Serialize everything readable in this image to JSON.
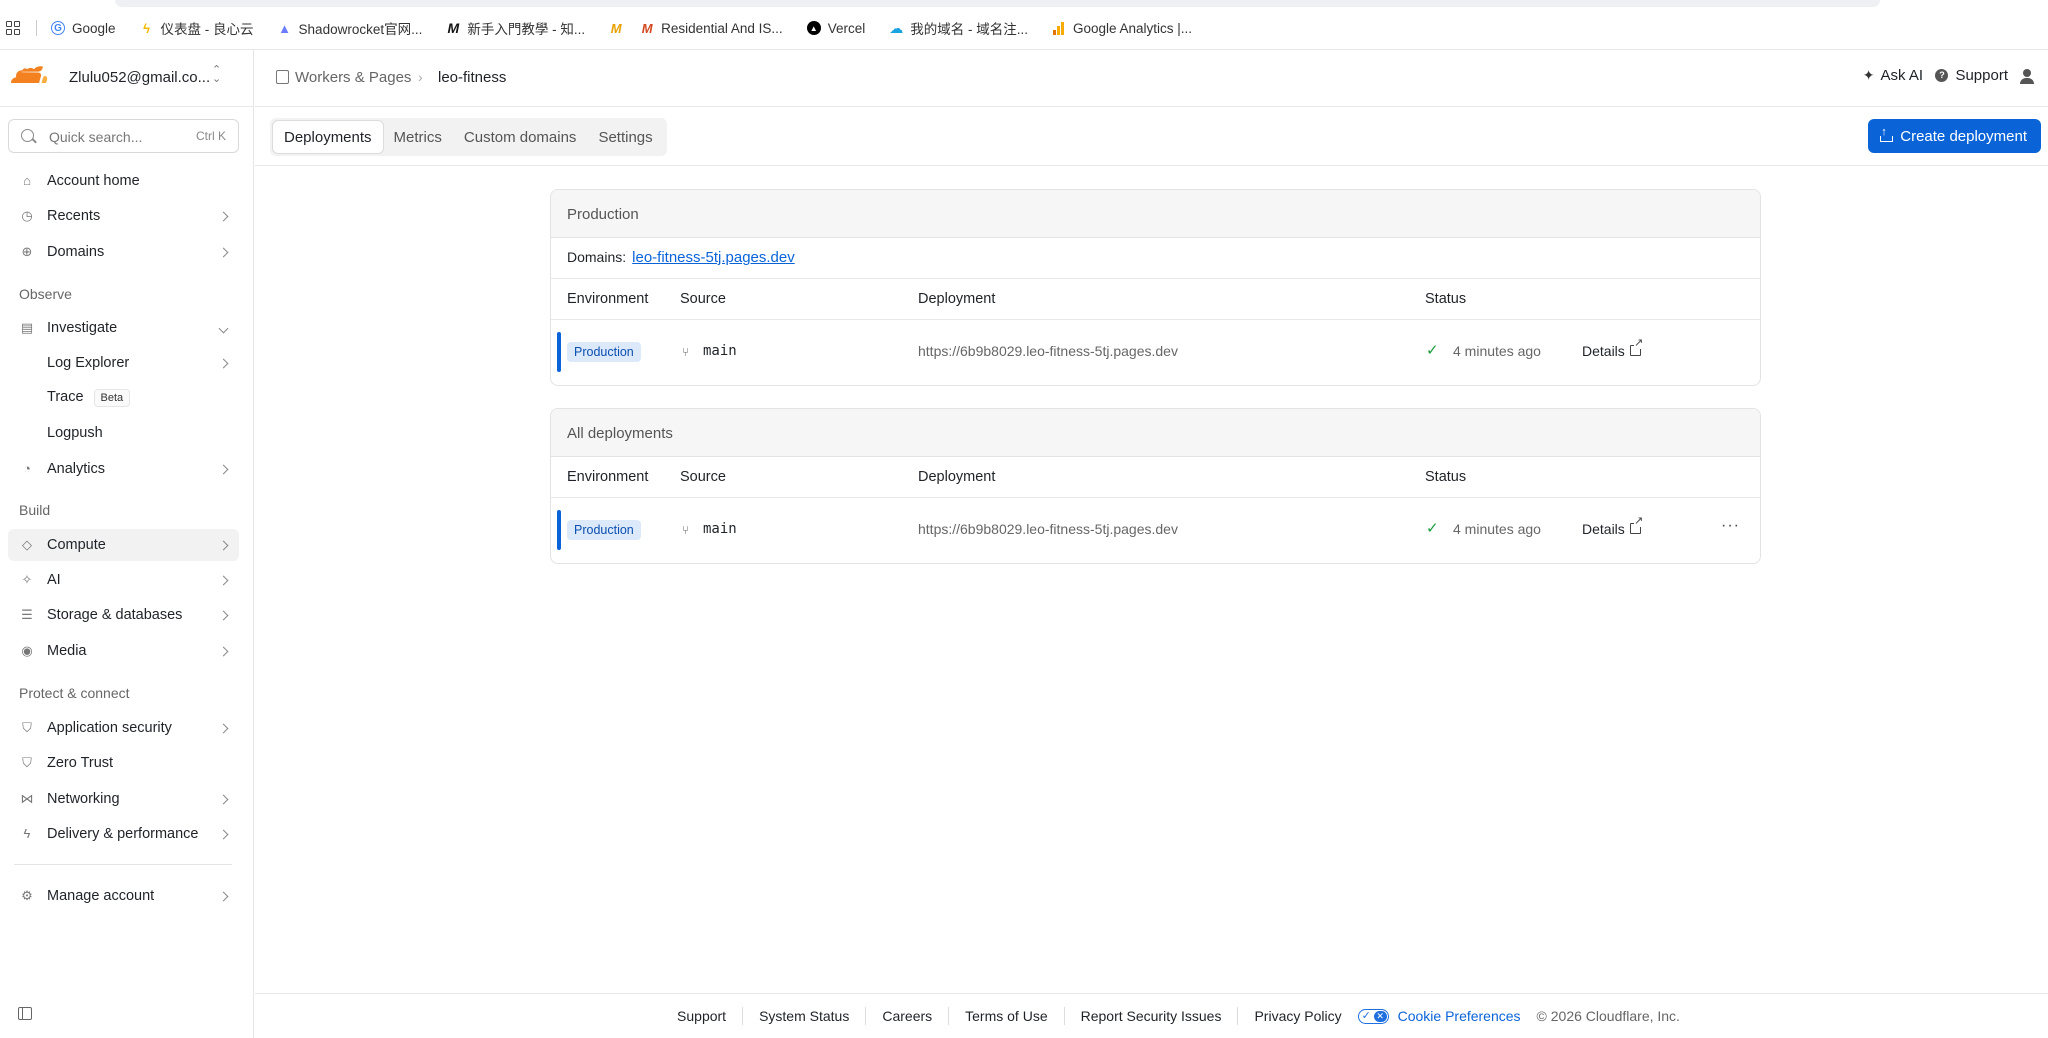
{
  "bookmarks": [
    {
      "label": "Google",
      "icon": "google-icon",
      "color": "#4285f4"
    },
    {
      "label": "仪表盘 - 良心云",
      "icon": "lightning-icon",
      "color": "#f2b800"
    },
    {
      "label": "Shadowrocket官网...",
      "icon": "rocket-icon",
      "color": "#6b7cff"
    },
    {
      "label": "新手入門教學 - 知...",
      "icon": "m-logo-icon",
      "color": "#111111"
    },
    {
      "label": "",
      "icon": "m-logo-icon",
      "color": "#e8a000"
    },
    {
      "label": "Residential And IS...",
      "icon": "m-logo-icon",
      "color": "#d2471c"
    },
    {
      "label": "Vercel",
      "icon": "vercel-icon",
      "color": "#000000"
    },
    {
      "label": "我的域名 - 域名注...",
      "icon": "cloud-icon",
      "color": "#1aa3e0"
    },
    {
      "label": "Google Analytics |...",
      "icon": "analytics-icon",
      "color": "#f9ab00"
    }
  ],
  "account": {
    "email": "Zlulu052@gmail.co..."
  },
  "search": {
    "placeholder": "Quick search...",
    "shortcut": "Ctrl K"
  },
  "sidebar": {
    "account_home": "Account home",
    "recents": "Recents",
    "domains": "Domains",
    "observe_label": "Observe",
    "investigate": "Investigate",
    "log_explorer": "Log Explorer",
    "trace": "Trace",
    "trace_badge": "Beta",
    "logpush": "Logpush",
    "analytics": "Analytics",
    "build_label": "Build",
    "compute": "Compute",
    "ai": "AI",
    "storage": "Storage & databases",
    "media": "Media",
    "protect_label": "Protect & connect",
    "app_security": "Application security",
    "zero_trust": "Zero Trust",
    "networking": "Networking",
    "delivery": "Delivery & performance",
    "manage_account": "Manage account"
  },
  "breadcrumb": {
    "parent": "Workers & Pages",
    "current": "leo-fitness"
  },
  "header": {
    "ask_ai": "Ask AI",
    "support": "Support"
  },
  "tabs": [
    "Deployments",
    "Metrics",
    "Custom domains",
    "Settings"
  ],
  "create_button": "Create deployment",
  "production": {
    "title": "Production",
    "domains_label": "Domains:",
    "domain": "leo-fitness-5tj.pages.dev"
  },
  "all_deployments": {
    "title": "All deployments"
  },
  "columns": {
    "environment": "Environment",
    "source": "Source",
    "deployment": "Deployment",
    "status": "Status"
  },
  "row": {
    "environment": "Production",
    "branch": "main",
    "url": "https://6b9b8029.leo-fitness-5tj.pages.dev",
    "time": "4 minutes ago",
    "details": "Details",
    "more": "···"
  },
  "footer": {
    "support": "Support",
    "system_status": "System Status",
    "careers": "Careers",
    "terms": "Terms of Use",
    "report": "Report Security Issues",
    "privacy": "Privacy Policy",
    "cookie": "Cookie Preferences",
    "copyright": "© 2026 Cloudflare, Inc."
  },
  "colors": {
    "accent": "#0a64d8",
    "success": "#1a9e3b",
    "brand": "#f48120"
  }
}
